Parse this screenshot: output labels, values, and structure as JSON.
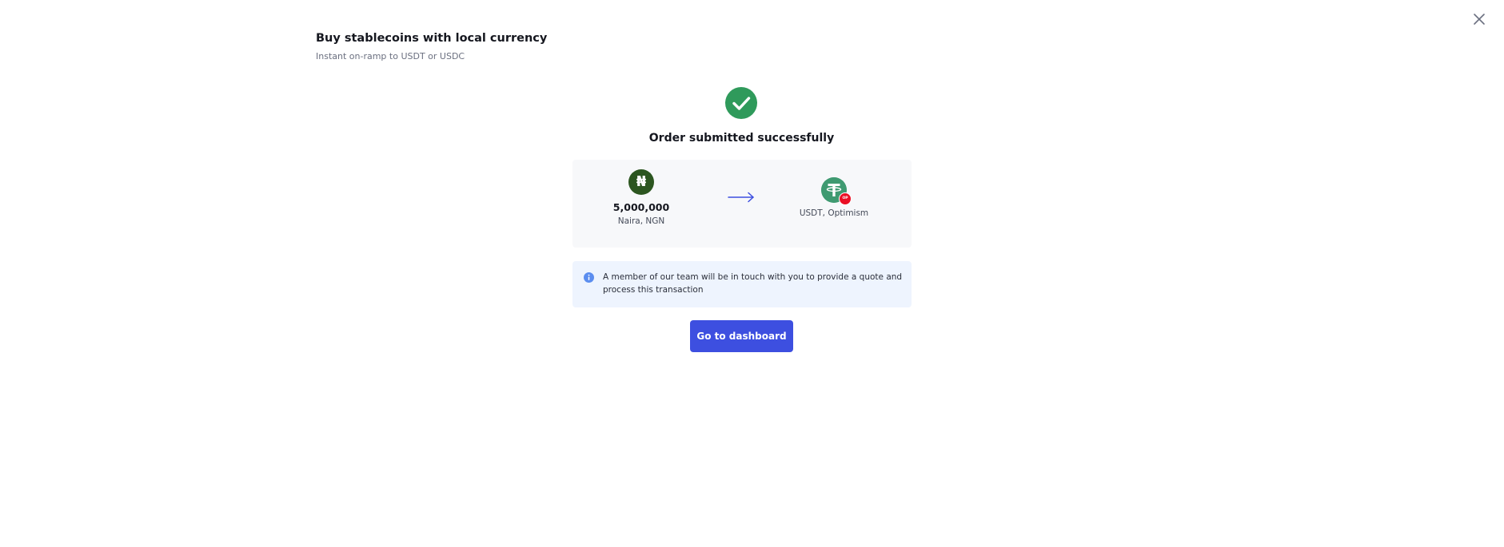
{
  "header": {
    "title": "Buy stablecoins with local currency",
    "subtitle": "Instant on-ramp to USDT or USDC"
  },
  "close_icon": "close-icon",
  "success": {
    "icon": "check-circle-icon",
    "title": "Order submitted successfully"
  },
  "conversion": {
    "from": {
      "icon": "naira-icon",
      "symbol": "₦",
      "amount": "5,000,000",
      "label": "Naira, NGN"
    },
    "arrow_icon": "arrow-right-icon",
    "to": {
      "icon": "usdt-icon",
      "badge_icon": "optimism-icon",
      "badge_text": "OP",
      "label": "USDT, Optimism"
    }
  },
  "info": {
    "icon": "info-icon",
    "text": "A member of our team will be in touch with you to provide a quote and process this transaction"
  },
  "actions": {
    "dashboard_label": "Go to dashboard"
  },
  "colors": {
    "accent": "#3d4fe0",
    "success": "#2f9a5b",
    "naira": "#2c5620",
    "usdt": "#3f9a71",
    "optimism": "#ea0f24",
    "info_bg": "#eef4fe",
    "card_bg": "#f7f8fa"
  }
}
